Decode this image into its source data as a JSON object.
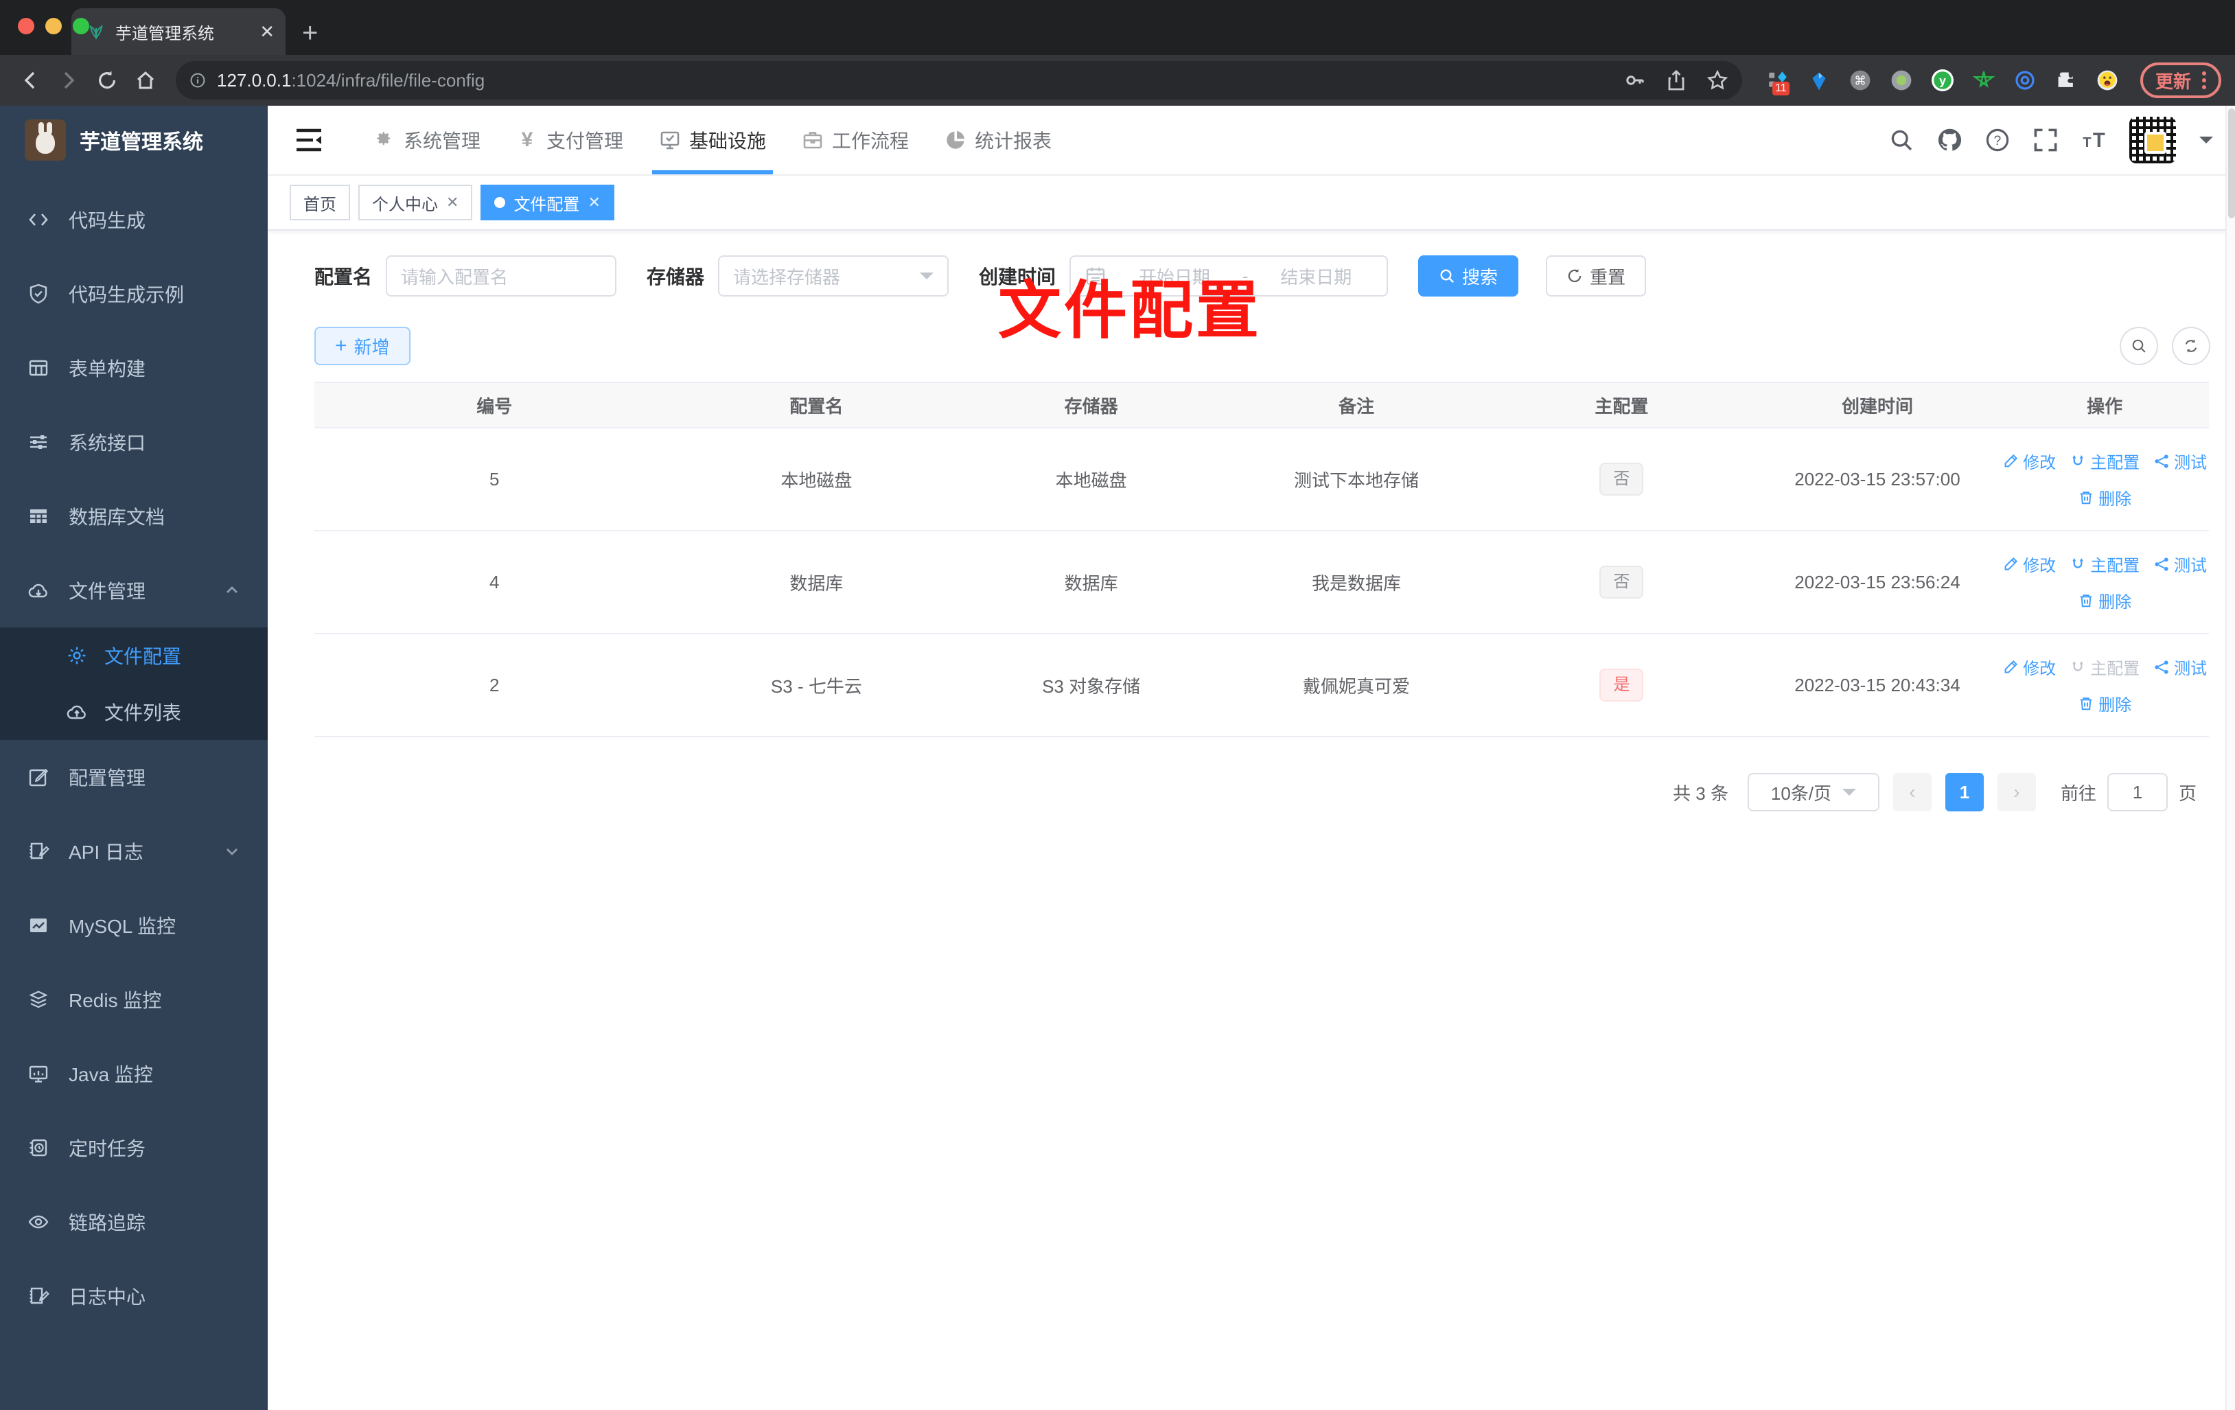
{
  "browser": {
    "tab_title": "芋道管理系统",
    "url_host": "127.0.0.1",
    "url_path": ":1024/infra/file/file-config",
    "new_tab": "+",
    "close_tab": "✕",
    "extension_badge": "11",
    "update_label": "更新"
  },
  "sidebar": {
    "title": "芋道管理系统",
    "items": [
      {
        "label": "代码生成"
      },
      {
        "label": "代码生成示例"
      },
      {
        "label": "表单构建"
      },
      {
        "label": "系统接口"
      },
      {
        "label": "数据库文档"
      },
      {
        "label": "文件管理"
      },
      {
        "label": "文件配置"
      },
      {
        "label": "文件列表"
      },
      {
        "label": "配置管理"
      },
      {
        "label": "API 日志"
      },
      {
        "label": "MySQL 监控"
      },
      {
        "label": "Redis 监控"
      },
      {
        "label": "Java 监控"
      },
      {
        "label": "定时任务"
      },
      {
        "label": "链路追踪"
      },
      {
        "label": "日志中心"
      }
    ]
  },
  "topnav": {
    "items": [
      {
        "label": "系统管理"
      },
      {
        "label": "支付管理"
      },
      {
        "label": "基础设施"
      },
      {
        "label": "工作流程"
      },
      {
        "label": "统计报表"
      }
    ]
  },
  "tabs": {
    "items": [
      {
        "label": "首页"
      },
      {
        "label": "个人中心"
      },
      {
        "label": "文件配置"
      }
    ]
  },
  "annotation": {
    "text": "文件配置"
  },
  "filter": {
    "name_label": "配置名",
    "name_placeholder": "请输入配置名",
    "storage_label": "存储器",
    "storage_placeholder": "请选择存储器",
    "time_label": "创建时间",
    "start_placeholder": "开始日期",
    "separator": "-",
    "end_placeholder": "结束日期",
    "search_label": "搜索",
    "reset_label": "重置"
  },
  "toolbar": {
    "add_label": "新增"
  },
  "table": {
    "headers": [
      "编号",
      "配置名",
      "存储器",
      "备注",
      "主配置",
      "创建时间",
      "操作"
    ],
    "actions": {
      "edit": "修改",
      "master": "主配置",
      "test": "测试",
      "delete": "删除"
    },
    "rows": [
      {
        "id": "5",
        "name": "本地磁盘",
        "storage": "本地磁盘",
        "remark": "测试下本地存储",
        "master": "否",
        "time": "2022-03-15 23:57:00"
      },
      {
        "id": "4",
        "name": "数据库",
        "storage": "数据库",
        "remark": "我是数据库",
        "master": "否",
        "time": "2022-03-15 23:56:24"
      },
      {
        "id": "2",
        "name": "S3 - 七牛云",
        "storage": "S3 对象存储",
        "remark": "戴佩妮真可爱",
        "master": "是",
        "time": "2022-03-15 20:43:34"
      }
    ]
  },
  "pagination": {
    "total": "共 3 条",
    "page_size": "10条/页",
    "current_page": "1",
    "goto_label": "前往",
    "goto_value": "1",
    "page_unit": "页"
  },
  "colors": {
    "accent": "#409eff",
    "danger": "#f56c6c",
    "annotation": "#fb1710"
  }
}
